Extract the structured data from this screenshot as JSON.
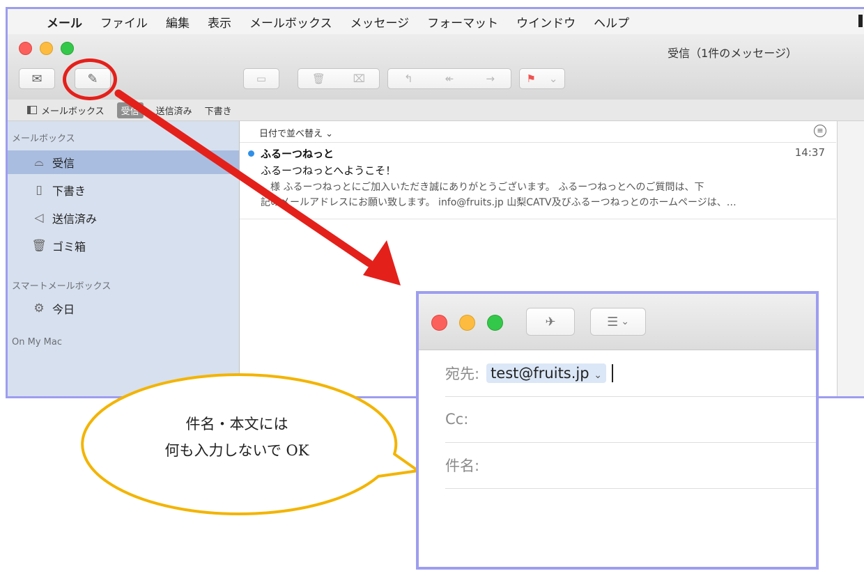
{
  "menubar": {
    "app": "メール",
    "items": [
      "ファイル",
      "編集",
      "表示",
      "メールボックス",
      "メッセージ",
      "フォーマット",
      "ウインドウ",
      "ヘルプ"
    ]
  },
  "window": {
    "title": "受信（1件のメッセージ）"
  },
  "favorites": {
    "mailboxes": "メールボックス",
    "inbox": "受信",
    "sent": "送信済み",
    "drafts": "下書き"
  },
  "sidebar": {
    "header_mailboxes": "メールボックス",
    "items": [
      {
        "label": "受信",
        "icon": "inbox-icon"
      },
      {
        "label": "下書き",
        "icon": "draft-icon"
      },
      {
        "label": "送信済み",
        "icon": "sent-icon"
      },
      {
        "label": "ゴミ箱",
        "icon": "trash-icon"
      }
    ],
    "header_smart": "スマートメールボックス",
    "smart_items": [
      {
        "label": "今日",
        "icon": "gear-icon"
      }
    ],
    "header_local": "On My Mac"
  },
  "message_list": {
    "sort_label": "日付で並べ替え ⌄",
    "message": {
      "sender": "ふるーつねっと",
      "time": "14:37",
      "subject": "ふるーつねっとへようこそ！",
      "preview_line1": "　様 ふるーつねっとにご加入いただき誠にありがとうございます。 ふるーつねっとへのご質問は、下",
      "preview_line2": "記のメールアドレスにお願い致します。 info@fruits.jp 山梨CATV及びふるーつねっとのホームページは、…"
    }
  },
  "compose": {
    "to_label": "宛先:",
    "to_value": "test@fruits.jp",
    "cc_label": "Cc:",
    "subject_label": "件名:"
  },
  "callout": {
    "line1": "件名・本文には",
    "line2": "何も入力しないで OK"
  },
  "colors": {
    "accent_red": "#e4201b",
    "callout_border": "#f3b400",
    "window_border": "#9d9df0",
    "selection": "#a9bde0",
    "sidebar_bg": "#d7e0ee",
    "unread_dot": "#2f8fe6"
  }
}
